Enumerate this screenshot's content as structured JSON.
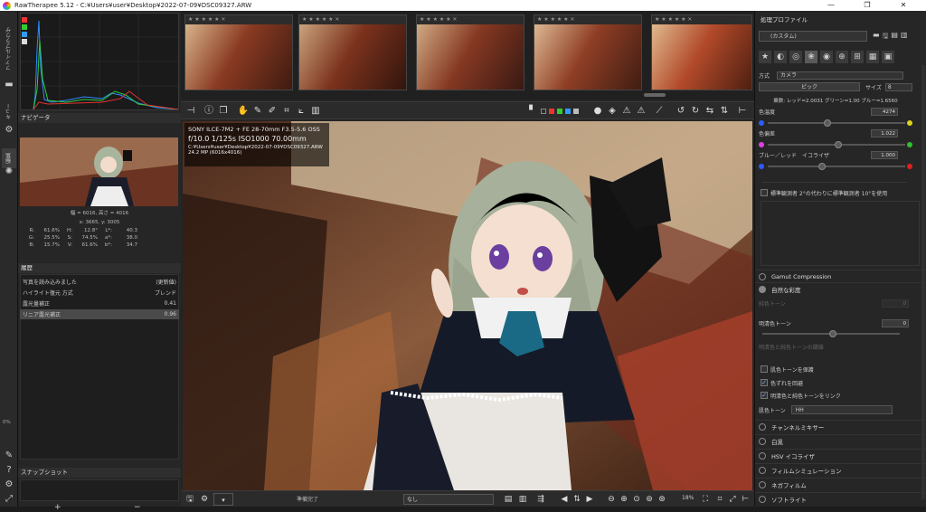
{
  "window": {
    "title": "RawTherapee 5.12 - C:¥Users¥user¥Desktop¥2022-07-09¥DSC09327.ARW",
    "minimize": "—",
    "maximize": "❐",
    "close": "✕"
  },
  "left_tabs": [
    {
      "label": "ファイルブラウザ"
    },
    {
      "label": "キュー"
    },
    {
      "label": "編集"
    }
  ],
  "left_panel": {
    "navigator_header": "ナビゲータ",
    "image_size": "幅 = 6016, 高さ = 4016",
    "cursor_xy": "x: 3665, y: 3005",
    "readout": [
      [
        "R:",
        "61.6%",
        "H:",
        "12.8°",
        "L*:",
        "40.3"
      ],
      [
        "G:",
        "25.5%",
        "S:",
        "74.5%",
        "a*:",
        "38.0"
      ],
      [
        "B:",
        "15.7%",
        "V:",
        "61.6%",
        "b*:",
        "34.7"
      ]
    ],
    "history_header": "履歴",
    "history": [
      {
        "label": "写真を読み込みました",
        "value": "(更新値)"
      },
      {
        "label": "ハイライト復元 方式",
        "value": "ブレンド"
      },
      {
        "label": "露光量補正",
        "value": "0.41"
      },
      {
        "label": "リニア露光補正",
        "value": "0.96"
      }
    ],
    "snapshot_header": "スナップショット",
    "snap_add": "+",
    "snap_remove": "−",
    "zoom_pct": "0%"
  },
  "center": {
    "exif": {
      "camera": "SONY ILCE-7M2 + FE 28-70mm F3.5-5.6 OSS",
      "settings": "f/10.0  1/125s  ISO1000  70.00mm",
      "path": "C:¥Users¥user¥Desktop¥2022-07-09¥DSC09327.ARW",
      "size": "24.2 MP (6016x4016)"
    },
    "status": "準備完了",
    "profile_select": "なし",
    "zoom": "18%"
  },
  "right_panel": {
    "header": "処理プロファイル",
    "profile": "(カスタム)",
    "wb_method_label": "方式",
    "wb_method": "カメラ",
    "pick_button": "ピック",
    "size_label": "サイズ",
    "size_value": "8",
    "multipliers": "乗数: レッド=2.0031 グリーン=1.00 ブルー=1.6560",
    "color_temp_label": "色温度",
    "color_temp": "4274",
    "tint_label": "色偏差",
    "tint": "1.022",
    "blue_red_label": "ブルー／レッド　イコライザ",
    "blue_red": "1.000",
    "std_observer": "標準観測者 2°の代わりに標準観測者 10°を使用",
    "gamut_label": "Gamut Compression",
    "vibrance_label": "自然な彩度",
    "pastel_label": "純色トーン",
    "pastel": "0",
    "sat_label": "明清色トーン",
    "sat": "0",
    "pastel_sat_label": "明清色と純色トーンの閾値",
    "protect_skin": "肌色トーンを保護",
    "avoid_shift": "色ずれを回避",
    "link_tones": "明清色と純色トーンをリンク",
    "skin_curve_label": "肌色トーン",
    "skin_curve_value": "HH",
    "tools": [
      "チャンネルミキサー",
      "白黒",
      "HSV イコライザ",
      "フィルムシミュレーション",
      "ネガフィルム",
      "ソフトライト"
    ]
  }
}
